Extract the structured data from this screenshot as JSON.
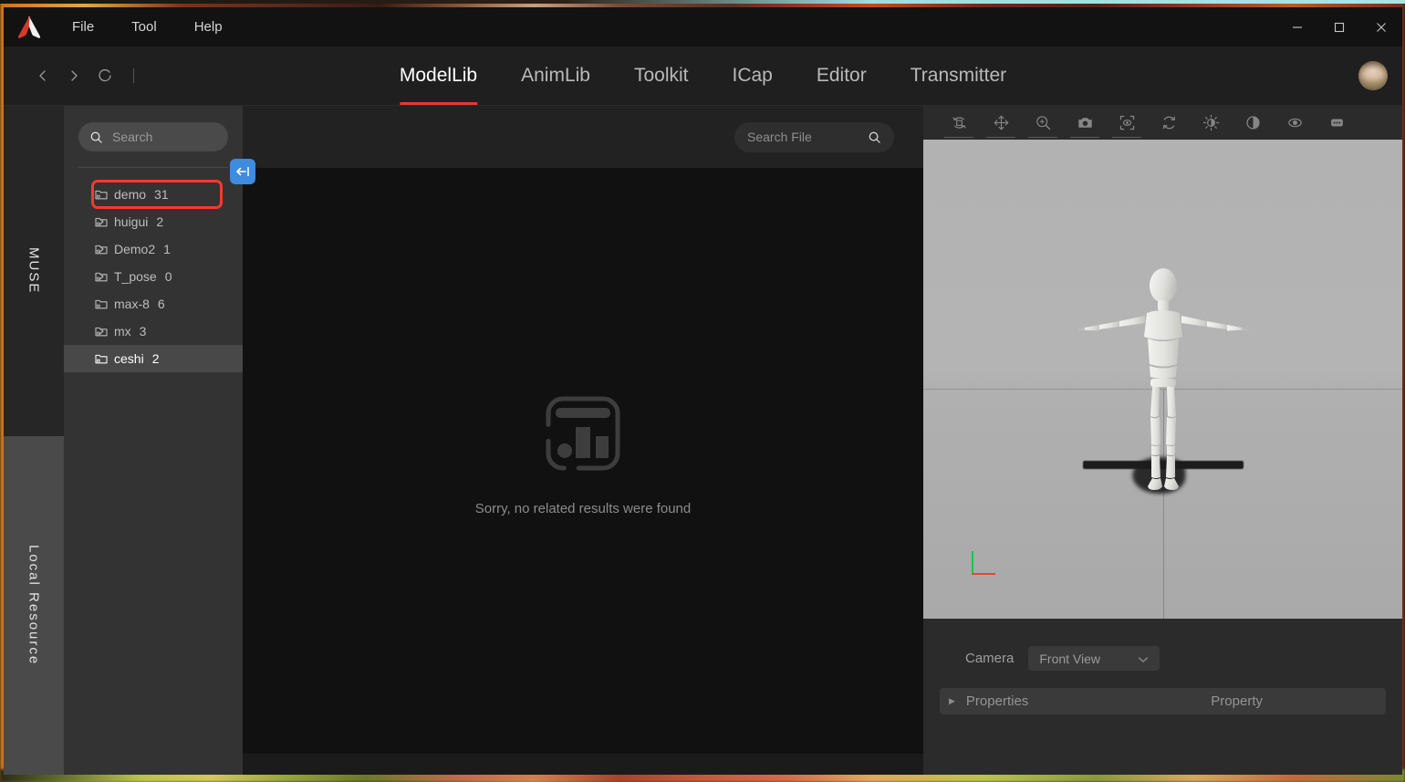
{
  "window": {
    "minimize_label": "─",
    "maximize_label": "□",
    "close_label": "✕"
  },
  "titlebar": {
    "logo": "muse-logo-icon",
    "menus": [
      {
        "label": "File"
      },
      {
        "label": "Tool"
      },
      {
        "label": "Help"
      }
    ]
  },
  "navbar": {
    "back": "back-chevron-icon",
    "forward": "forward-chevron-icon",
    "refresh": "refresh-icon",
    "tabs": [
      {
        "label": "ModelLib",
        "active": true
      },
      {
        "label": "AnimLib",
        "active": false
      },
      {
        "label": "Toolkit",
        "active": false
      },
      {
        "label": "ICap",
        "active": false
      },
      {
        "label": "Editor",
        "active": false
      },
      {
        "label": "Transmitter",
        "active": false
      }
    ],
    "accent_color": "#e23b2e",
    "avatar": "user-avatar"
  },
  "rail": {
    "tabs": [
      {
        "label": "MUSE",
        "active": true
      },
      {
        "label": "Local Resource",
        "active": false
      }
    ]
  },
  "sidebar": {
    "search": {
      "placeholder": "Search",
      "value": ""
    },
    "collapse_button": "collapse-panel-icon",
    "highlight_color": "#f8392b",
    "tree": [
      {
        "name": "demo",
        "count": "31",
        "expandable": false,
        "selected": false,
        "highlighted": true
      },
      {
        "name": "huigui",
        "count": "2",
        "expandable": true,
        "selected": false,
        "highlighted": false
      },
      {
        "name": "Demo2",
        "count": "1",
        "expandable": true,
        "selected": false,
        "highlighted": false
      },
      {
        "name": "T_pose",
        "count": "0",
        "expandable": true,
        "selected": false,
        "highlighted": false
      },
      {
        "name": "max-8",
        "count": "6",
        "expandable": false,
        "selected": false,
        "highlighted": false
      },
      {
        "name": "mx",
        "count": "3",
        "expandable": true,
        "selected": false,
        "highlighted": false
      },
      {
        "name": "ceshi",
        "count": "2",
        "expandable": false,
        "selected": true,
        "highlighted": false
      }
    ]
  },
  "content": {
    "search": {
      "placeholder": "Search File",
      "value": ""
    },
    "empty_state": {
      "icon": "no-results-icon",
      "message": "Sorry, no related results were found"
    }
  },
  "viewer": {
    "toolbar": [
      {
        "name": "rotate-object-icon",
        "underlined": true
      },
      {
        "name": "pan-move-icon",
        "underlined": true
      },
      {
        "name": "zoom-in-icon",
        "underlined": true
      },
      {
        "name": "camera-snapshot-icon",
        "underlined": true
      },
      {
        "name": "focus-target-icon",
        "underlined": true
      },
      {
        "name": "reset-rotation-icon",
        "underlined": false
      },
      {
        "name": "brightness-icon",
        "underlined": false
      },
      {
        "name": "contrast-icon",
        "underlined": false
      },
      {
        "name": "visibility-eye-icon",
        "underlined": false
      },
      {
        "name": "more-options-icon",
        "underlined": false
      }
    ],
    "viewport": {
      "model": "t-pose-mannequin",
      "gizmo": {
        "x_axis_color": "#e0483c",
        "y_axis_color": "#19c93a"
      }
    },
    "camera": {
      "label": "Camera",
      "selected_view": "Front View"
    },
    "properties": {
      "left_label": "Properties",
      "right_label": "Property"
    }
  }
}
